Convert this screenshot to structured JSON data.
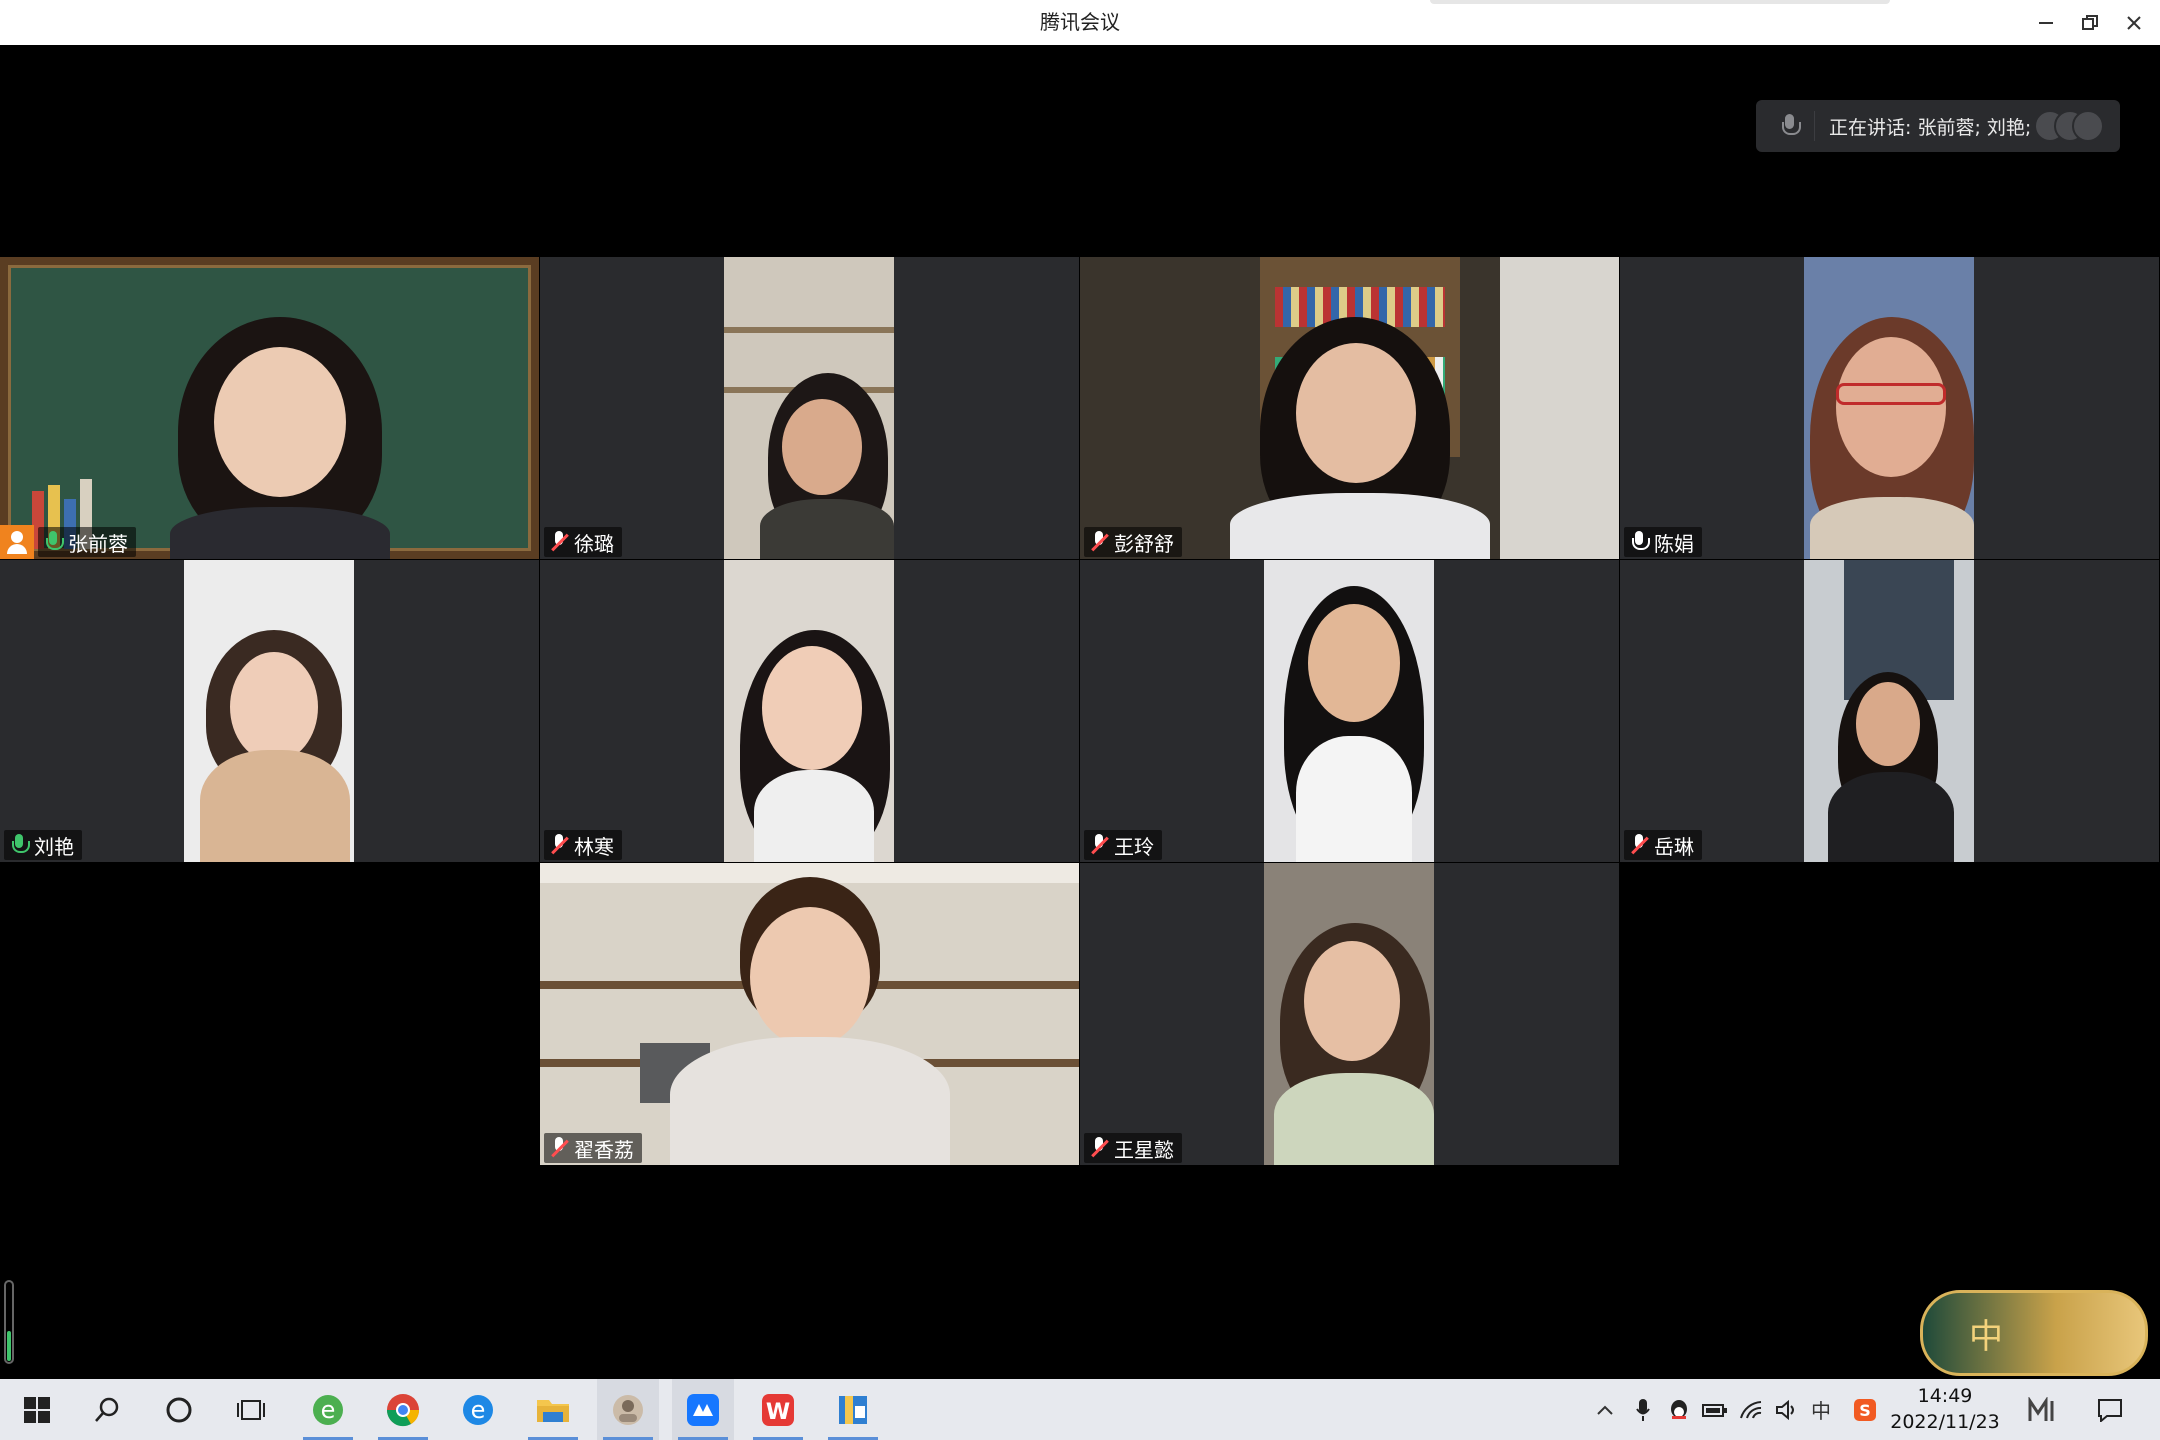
{
  "window": {
    "title": "腾讯会议",
    "minimize_icon": "minimize-icon",
    "restore_icon": "restore-icon",
    "close_icon": "close-icon"
  },
  "speaking": {
    "text": "正在讲话: 张前蓉; 刘艳;"
  },
  "participants": [
    {
      "name": "张前蓉",
      "mic": "on",
      "host": true
    },
    {
      "name": "徐璐",
      "mic": "off"
    },
    {
      "name": "彭舒舒",
      "mic": "off"
    },
    {
      "name": "陈娟",
      "mic": "unmuted"
    },
    {
      "name": "刘艳",
      "mic": "on"
    },
    {
      "name": "林寒",
      "mic": "off"
    },
    {
      "name": "王玲",
      "mic": "off"
    },
    {
      "name": "岳琳",
      "mic": "off"
    },
    {
      "name": "翟香荔",
      "mic": "off"
    },
    {
      "name": "王星懿",
      "mic": "off"
    }
  ],
  "badge": {
    "glyph": "中"
  },
  "taskbar": {
    "apps": [
      "windows-start",
      "search",
      "cortana",
      "task-view",
      "ie-browser",
      "chrome",
      "edge-legacy",
      "file-explorer",
      "photo-app",
      "tencent-meeting",
      "wps-office",
      "archive-app"
    ],
    "tray": {
      "ime": "中",
      "time": "14:49",
      "date": "2022/11/23"
    }
  },
  "colors": {
    "tile_bg": "#2a2b2e",
    "stage_bg": "#000000",
    "speaking_green": "#3fc56b",
    "muted_red": "#ff4d4f",
    "host_orange": "#f0831e",
    "taskbar_bg": "#e7e9ee"
  }
}
